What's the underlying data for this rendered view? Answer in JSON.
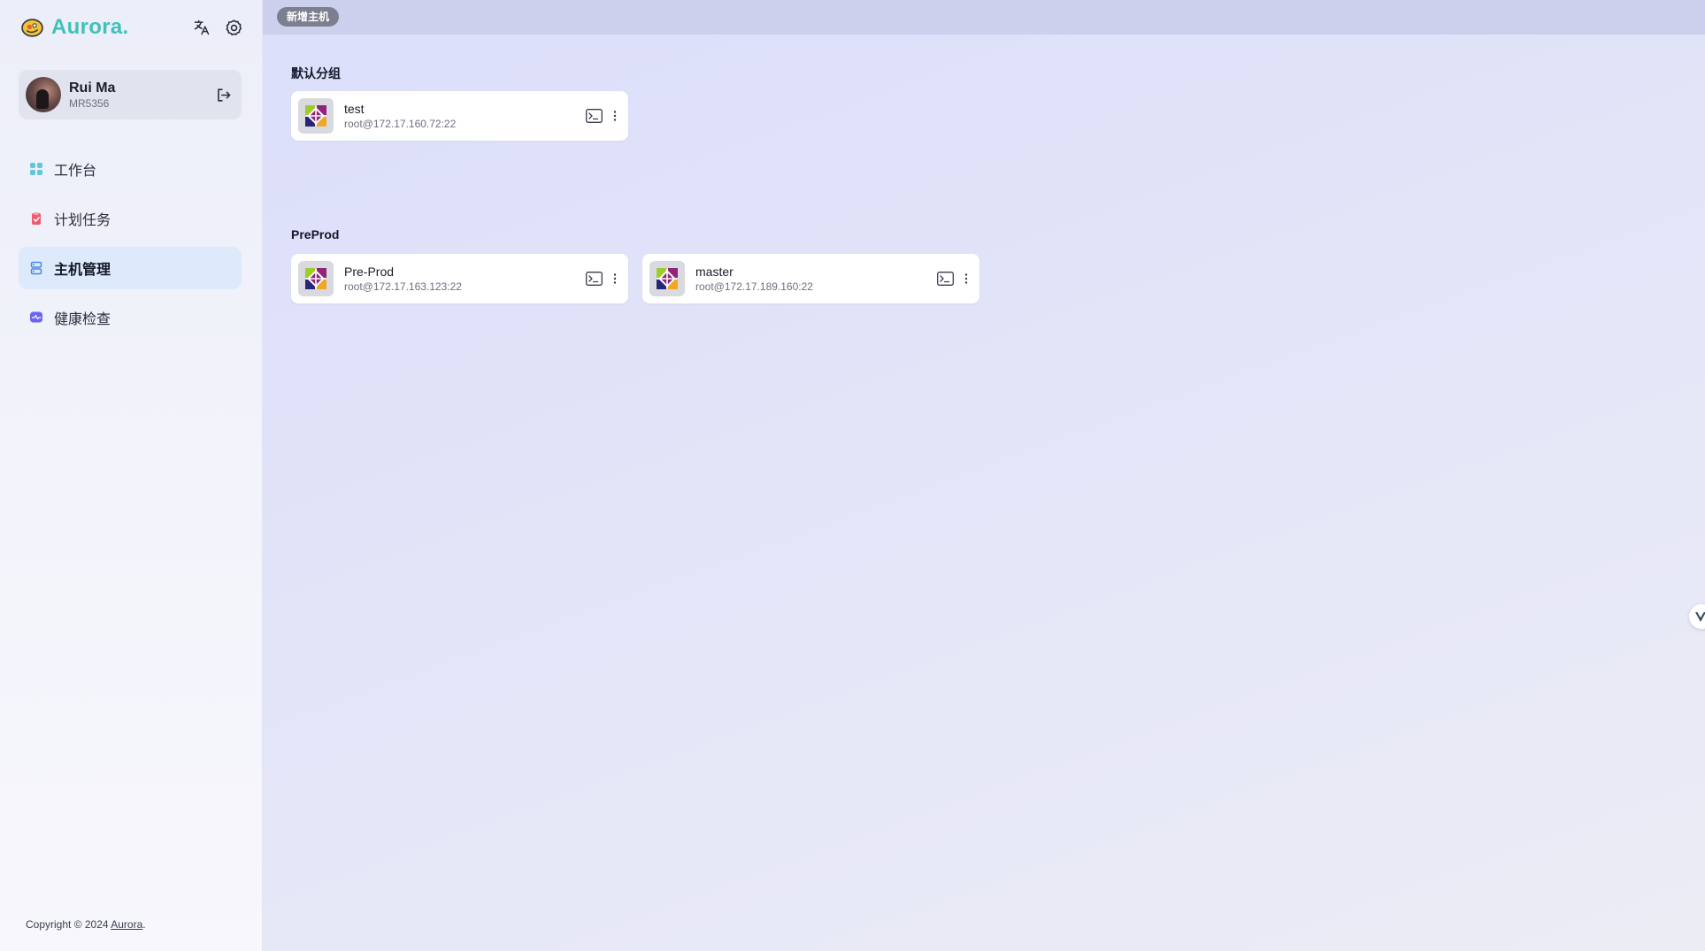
{
  "brand": {
    "name": "Aurora.",
    "logo_icon": "flower-logo-icon",
    "accent": "#3fc2b8"
  },
  "header_icons": [
    {
      "name": "translate-icon"
    },
    {
      "name": "settings-icon"
    }
  ],
  "user": {
    "name": "Rui Ma",
    "id": "MR5356"
  },
  "nav": {
    "items": [
      {
        "label": "工作台",
        "icon": "dashboard-icon",
        "active": false
      },
      {
        "label": "计划任务",
        "icon": "task-icon",
        "active": false
      },
      {
        "label": "主机管理",
        "icon": "server-icon",
        "active": true
      },
      {
        "label": "健康检查",
        "icon": "health-icon",
        "active": false
      }
    ]
  },
  "footer": {
    "prefix": "Copyright © 2024 ",
    "link": "Aurora",
    "suffix": "."
  },
  "toolbar": {
    "add_host_label": "新增主机"
  },
  "groups": [
    {
      "title": "默认分组",
      "hosts": [
        {
          "name": "test",
          "address": "root@172.17.160.72:22"
        }
      ]
    },
    {
      "title": "PreProd",
      "hosts": [
        {
          "name": "Pre-Prod",
          "address": "root@172.17.163.123:22"
        },
        {
          "name": "master",
          "address": "root@172.17.189.160:22"
        }
      ]
    }
  ]
}
